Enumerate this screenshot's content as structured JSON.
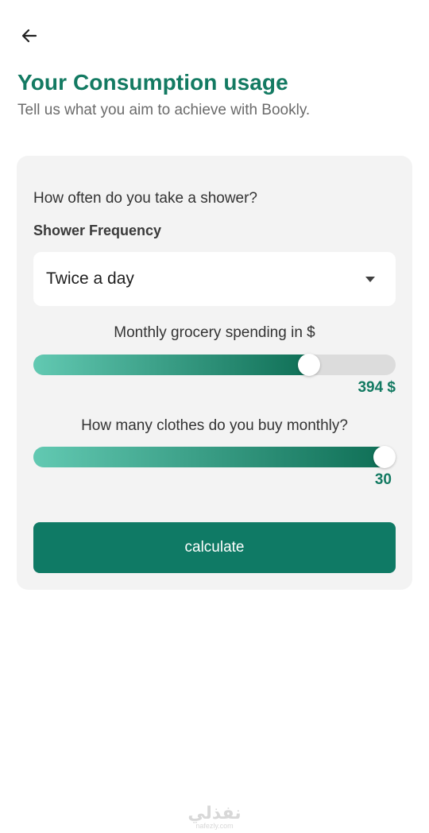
{
  "header": {
    "back_icon": "arrow-left-icon",
    "title": "Your Consumption usage",
    "subtitle": "Tell us what you aim to achieve with Bookly."
  },
  "form": {
    "question": "How often do you take a shower?",
    "shower_label": "Shower Frequency",
    "shower_value": "Twice a day",
    "dropdown_icon": "caret-down-icon",
    "grocery": {
      "label": "Monthly grocery spending in $",
      "value_text": "394 $",
      "fraction": 0.76
    },
    "clothes": {
      "label": "How many clothes do you buy monthly?",
      "value_text": "30",
      "fraction": 0.97
    },
    "calculate_label": "calculate"
  },
  "watermark": {
    "arabic": "نفذلي",
    "latin": "nafezly.com"
  },
  "colors": {
    "accent": "#137a62",
    "button": "#0f7a65",
    "slider_start": "#62c9b2",
    "slider_end": "#0f6f56",
    "card_bg": "#f3f3f3"
  }
}
